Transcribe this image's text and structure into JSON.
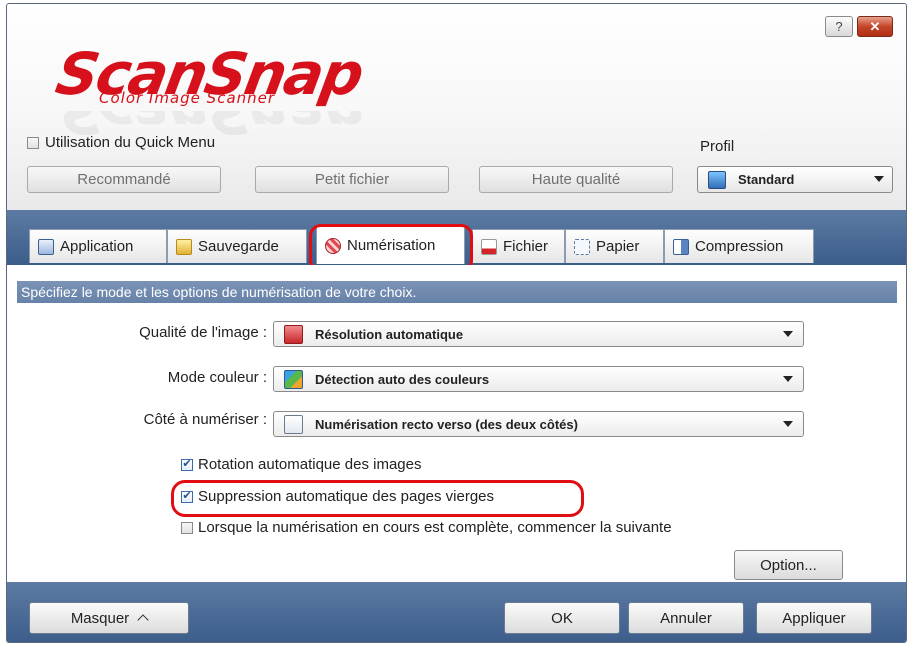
{
  "window": {
    "help_label": "?",
    "close_label": "✕"
  },
  "logo": {
    "main": "ScanSnap",
    "sub": "Color Image Scanner"
  },
  "quick_menu": {
    "label": "Utilisation du Quick Menu",
    "checked": false
  },
  "profile": {
    "label": "Profil",
    "buttons": [
      "Recommandé",
      "Petit fichier",
      "Haute qualité"
    ],
    "selected": "Standard"
  },
  "tabs": [
    {
      "label": "Application"
    },
    {
      "label": "Sauvegarde"
    },
    {
      "label": "Numérisation",
      "active": true
    },
    {
      "label": "Fichier"
    },
    {
      "label": "Papier"
    },
    {
      "label": "Compression"
    }
  ],
  "banner": "Spécifiez le mode et les options de numérisation de votre choix.",
  "fields": [
    {
      "label": "Qualité de l'image :",
      "value": "Résolution automatique"
    },
    {
      "label": "Mode couleur :",
      "value": "Détection auto des couleurs"
    },
    {
      "label": "Côté à numériser :",
      "value": "Numérisation recto verso (des deux côtés)"
    }
  ],
  "options": [
    {
      "label": "Rotation automatique des images",
      "checked": true
    },
    {
      "label": "Suppression automatique des pages vierges",
      "checked": true
    },
    {
      "label": "Lorsque la numérisation en cours est complète, commencer la suivante",
      "checked": false
    }
  ],
  "option_button": "Option...",
  "footer": {
    "hide": "Masquer",
    "ok": "OK",
    "cancel": "Annuler",
    "apply": "Appliquer"
  },
  "colors": {
    "brand_red": "#d6111b",
    "highlight_red": "#e00d12",
    "band_blue": "#4a6b97",
    "banner_blue": "#6f89ae"
  },
  "icons": {
    "help": "help-icon",
    "close": "close-icon",
    "profile": "profile-standard-icon",
    "tabs": [
      "application-icon",
      "folder-icon",
      "scan-icon",
      "file-icon",
      "paper-icon",
      "compression-icon"
    ],
    "fields": [
      "image-quality-icon",
      "color-mode-icon",
      "scan-side-icon"
    ],
    "hide_chevron": "chevron-up-icon"
  }
}
